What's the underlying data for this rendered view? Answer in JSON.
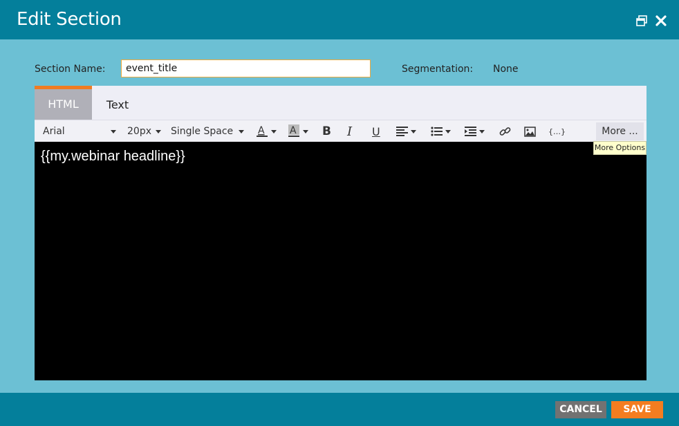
{
  "dialog": {
    "title": "Edit Section"
  },
  "form": {
    "section_name_label": "Section Name:",
    "section_name_value": "event_title",
    "segmentation_label": "Segmentation:",
    "segmentation_value": "None"
  },
  "tabs": [
    {
      "label": "HTML",
      "active": true
    },
    {
      "label": "Text",
      "active": false
    }
  ],
  "toolbar": {
    "font_family": "Arial",
    "font_size": "20px",
    "line_spacing": "Single Space",
    "more_label": "More ...",
    "icons": [
      "font-color-icon",
      "highlight-color-icon",
      "bold-icon",
      "italic-icon",
      "underline-icon",
      "align-icon",
      "list-icon",
      "indent-icon",
      "link-icon",
      "image-icon",
      "token-icon"
    ]
  },
  "tooltip": {
    "text": "More Options"
  },
  "editor": {
    "content": "{{my.webinar headline}}"
  },
  "footer": {
    "cancel_label": "CANCEL",
    "save_label": "SAVE"
  },
  "colors": {
    "header": "#047f9b",
    "body": "#6cc0d4",
    "accent": "#f07c22",
    "save": "#f47d20",
    "cancel": "#727272"
  }
}
